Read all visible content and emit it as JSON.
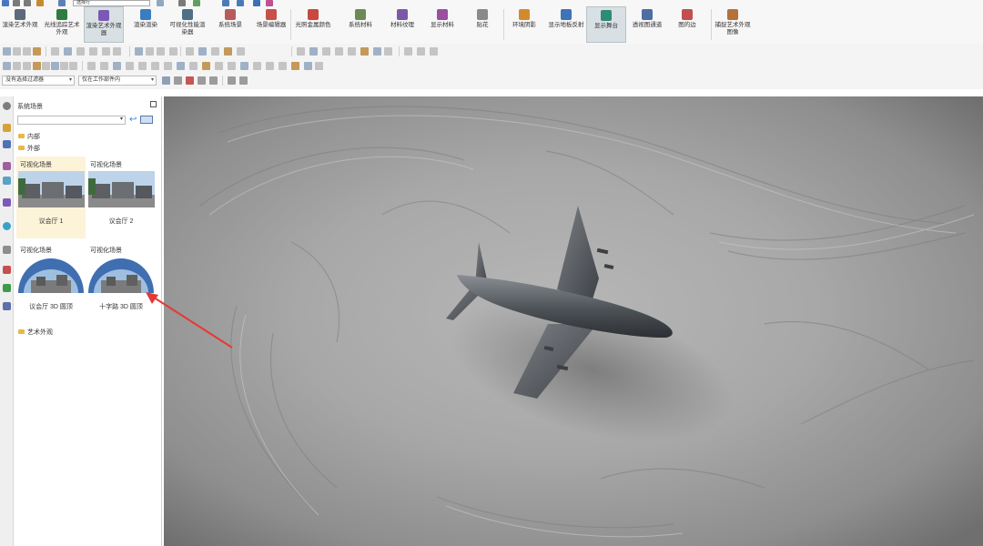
{
  "quick_access": {
    "field_value": "选择行"
  },
  "ribbon": {
    "buttons": [
      {
        "label": "渲染艺术外观",
        "color": "#5b6b7a"
      },
      {
        "label": "光线追踪艺术外观",
        "color": "#2f7d3e"
      },
      {
        "label": "渲染艺术外观器",
        "color": "#7b58b6"
      },
      {
        "label": "渲染渲染",
        "color": "#3a7cc1"
      },
      {
        "label": "可视化性能渲染器",
        "color": "#4f6f86"
      },
      {
        "label": "系统场景",
        "color": "#b85a5a"
      },
      {
        "label": "场景编辑器",
        "color": "#c8504a"
      },
      {
        "label": "光照金属颜色",
        "color": "#c9483f"
      },
      {
        "label": "系统材料",
        "color": "#6c8a55"
      },
      {
        "label": "材料纹理",
        "color": "#7a5aa8"
      },
      {
        "label": "显示材料",
        "color": "#9a4fa0"
      },
      {
        "label": "贴花",
        "color": "#8a8a8a"
      },
      {
        "label": "环境阴影",
        "color": "#d38a2f"
      },
      {
        "label": "显示地板反射",
        "color": "#3f73b8"
      },
      {
        "label": "显示舞台",
        "color": "#2e8b78"
      },
      {
        "label": "透视图通道",
        "color": "#4d6da3"
      },
      {
        "label": "图的边",
        "color": "#c24f4f"
      },
      {
        "label": "捕捉艺术外观图像",
        "color": "#b5713a"
      }
    ]
  },
  "toolbar3": {
    "filter_value": "没有选择过滤器",
    "scope_value": "仅在工作部件内"
  },
  "panel": {
    "title": "系统场景",
    "tree": {
      "internal": "内部",
      "external": "外部",
      "art": "艺术外观"
    },
    "cards": [
      {
        "category": "可视化场景",
        "name": "议会厅 1",
        "kind": "flat"
      },
      {
        "category": "可视化场景",
        "name": "议会厅 2",
        "kind": "flat"
      },
      {
        "category": "可视化场景",
        "name": "议会厅 3D 圆顶",
        "kind": "dome"
      },
      {
        "category": "可视化场景",
        "name": "十字路 3D 圆顶",
        "kind": "dome"
      }
    ]
  },
  "annotation": {
    "arrow_color": "#e53935"
  }
}
